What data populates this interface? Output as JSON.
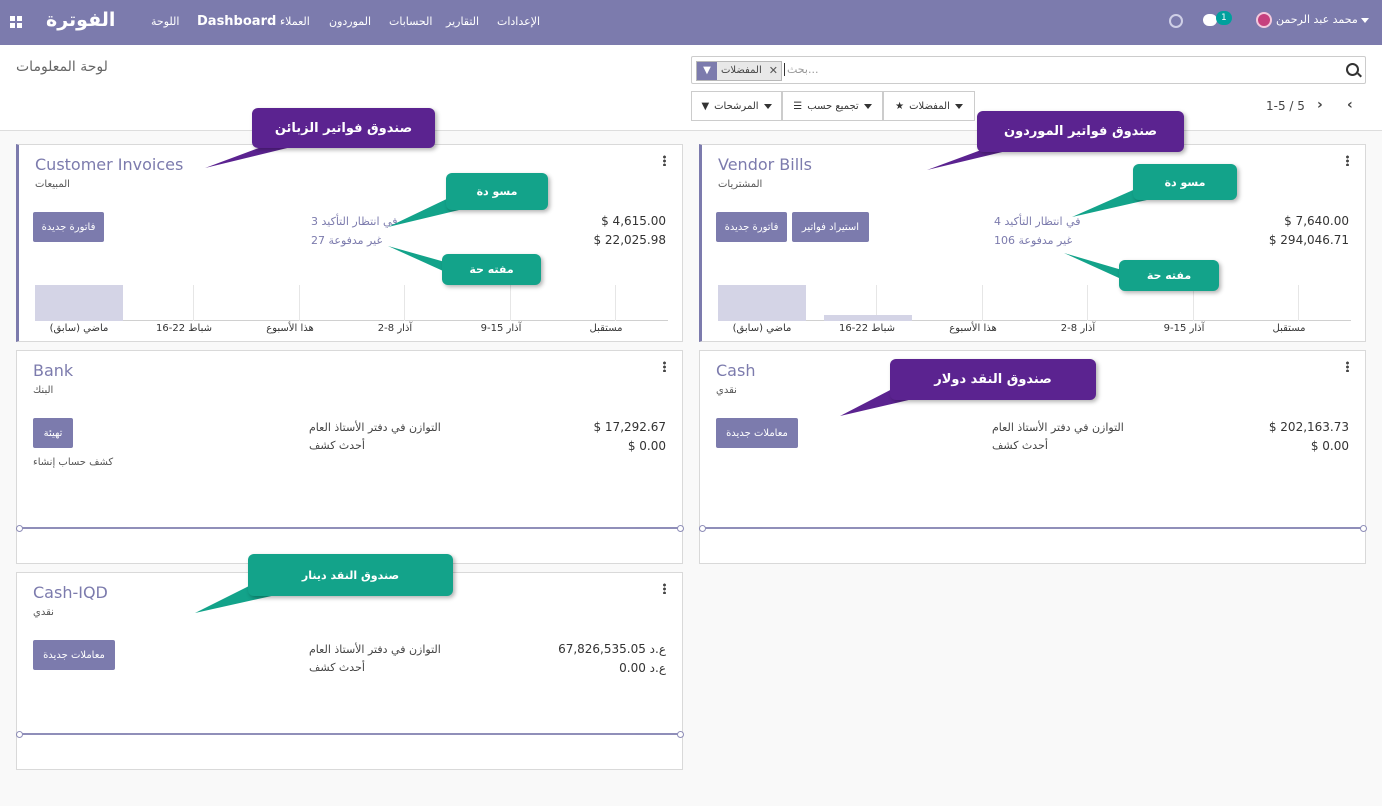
{
  "navbar": {
    "brand": "الفوترة",
    "menu": [
      "اللوحة",
      "Dashboard",
      "العملاء",
      "الموردون",
      "الحسابات",
      "التقارير",
      "الإعدادات"
    ],
    "chat_count": "1",
    "user_name": "محمد عبد الرحمن",
    "accent": "#7c7bad"
  },
  "control": {
    "page_title": "لوحة المعلومات",
    "facet": "المفضلات",
    "search_placeholder": "بحث...",
    "filters": "المرشحات",
    "group_by": "تجميع حسب",
    "favorites": "المفضلات",
    "pager": "1-5 / 5"
  },
  "cards": {
    "customer": {
      "title": "Customer Invoices",
      "subtitle": "المبيعات",
      "button": "فاتورة جديدة",
      "rows": [
        {
          "label": "في انتظار التأكيد 3",
          "amount": "$ 4,615.00"
        },
        {
          "label": "غير مدفوعة 27",
          "amount": "$ 22,025.98"
        }
      ],
      "bars": [
        1,
        0,
        0,
        0,
        0,
        0
      ],
      "axis": [
        "(ماضي (سابق",
        "شباط 22-16",
        "هذا الأسبوع",
        "آذار 8-2",
        "آذار 15-9",
        "مستقبل"
      ]
    },
    "vendor": {
      "title": "Vendor Bills",
      "subtitle": "المشتريات",
      "button": "فاتورة جديدة",
      "button2": "استيراد فواتير",
      "rows": [
        {
          "label": "في انتظار التأكيد 4",
          "amount": "$ 7,640.00"
        },
        {
          "label": "غير مدفوعة 106",
          "amount": "$ 294,046.71"
        }
      ],
      "bars": [
        1,
        0.18,
        0,
        0,
        0,
        0
      ],
      "axis": [
        "(ماضي (سابق",
        "شباط 22-16",
        "هذا الأسبوع",
        "آذار 8-2",
        "آذار 15-9",
        "مستقبل"
      ]
    },
    "bank": {
      "title": "Bank",
      "subtitle": "البنك",
      "button": "تهيئة",
      "link": "كشف حساب إنشاء",
      "rows": [
        {
          "label": "التوازن في دفتر الأستاذ العام",
          "amount": "$ 17,292.67"
        },
        {
          "label": "أحدث كشف",
          "amount": "$ 0.00"
        }
      ]
    },
    "cash": {
      "title": "Cash",
      "subtitle": "نقدي",
      "button": "معاملات جديدة",
      "rows": [
        {
          "label": "التوازن في دفتر الأستاذ العام",
          "amount": "$ 202,163.73"
        },
        {
          "label": "أحدث كشف",
          "amount": "$ 0.00"
        }
      ]
    },
    "cashiqd": {
      "title": "Cash-IQD",
      "subtitle": "نقدي",
      "button": "معاملات جديدة",
      "rows": [
        {
          "label": "التوازن في دفتر الأستاذ العام",
          "amount": "67,826,535.05 ع.د"
        },
        {
          "label": "أحدث كشف",
          "amount": "0.00 ع.د"
        }
      ]
    }
  },
  "callouts": {
    "customer": "صندوق فواتير الزبائن",
    "vendor": "صندوق فواتير الموردون",
    "draft1": "مسو دة",
    "open1": "مفته حة",
    "draft2": "مسو دة",
    "open2": "مفته حة",
    "cash_usd": "صندوق النقد دولار",
    "cash_iqd": "صندوق النقد دينار"
  }
}
